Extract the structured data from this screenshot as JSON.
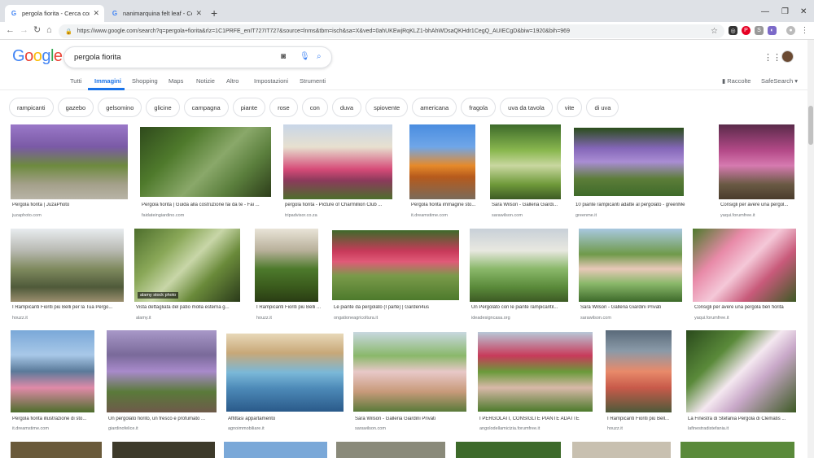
{
  "browser": {
    "tabs": [
      {
        "title": "pergola fiorita - Cerca con Google",
        "active": true
      },
      {
        "title": "nanimarquina felt leaf - Cerca con Google",
        "active": false
      }
    ],
    "url": "https://www.google.com/search?q=pergola+fiorita&rlz=1C1PRFE_enIT727IT727&source=lnms&tbm=isch&sa=X&ved=0ahUKEwjRqKLZ1-bhAhWDsaQKHdr1CegQ_AUIECgD&biw=1920&bih=969"
  },
  "google": {
    "logo": "Google",
    "query": "pergola fiorita",
    "tabs": [
      "Tutti",
      "Immagini",
      "Shopping",
      "Maps",
      "Notizie",
      "Altro",
      "Impostazioni",
      "Strumenti"
    ],
    "raccolte": "Raccolte",
    "safesearch": "SafeSearch ▾",
    "chips": [
      "rampicanti",
      "gazebo",
      "gelsomino",
      "glicine",
      "campagna",
      "piante",
      "rose",
      "con",
      "duva",
      "spiovente",
      "americana",
      "fragola",
      "uva da tavola",
      "vite",
      "di uva"
    ]
  },
  "results": [
    {
      "caption": "Pergola fiorita | JuzaPhoto",
      "source": "juzaphoto.com"
    },
    {
      "caption": "Pergola fiorita | Guida alla costruzione fai da te - Fai ...",
      "source": "faidateingiardino.com"
    },
    {
      "caption": "pergola fiorita - Picture of Charmillion Club ...",
      "source": "tripadvisor.co.za"
    },
    {
      "caption": "Pergola fiorita immagine sto...",
      "source": "it.dreamstime.com"
    },
    {
      "caption": "Sara Wilson - Galleria Giardi...",
      "source": "sarawilson.com"
    },
    {
      "caption": "10 piante rampicanti adatte al pergolato - greenMe",
      "source": "greenme.it"
    },
    {
      "caption": "Consigli per avere una pergol...",
      "source": "yaqui.forumfree.it"
    },
    {
      "caption": "I Rampicanti Fioriti più Belli per la Tua Pergo...",
      "source": "houzz.it"
    },
    {
      "caption": "Vista dettagliata del patio molla esterna g...",
      "source": "alamy.it"
    },
    {
      "caption": "I Rampicanti Fioriti più Belli ...",
      "source": "houzz.it"
    },
    {
      "caption": "Le piante da pergolato (I parte) | Garden4us",
      "source": "ongationeagricoltura.it"
    },
    {
      "caption": "Un Pergolato con le piante rampicantil...",
      "source": "ideadesigncasa.org"
    },
    {
      "caption": "Sara Wilson - Galleria Giardini Privati",
      "source": "sarawilson.com"
    },
    {
      "caption": "Consigli per avere una pergola ben fiorita",
      "source": "yaqui.forumfree.it"
    },
    {
      "caption": "Pergola fiorita illustrazione di sto...",
      "source": "it.dreamstime.com"
    },
    {
      "caption": "Un pergolato fiorito, un fresco e profumato ...",
      "source": "giardinofelice.it"
    },
    {
      "caption": "Affittasi appartamento",
      "source": "agnoimmobiliare.it"
    },
    {
      "caption": "Sara Wilson - Galleria Giardini Privati",
      "source": "sarawilson.com"
    },
    {
      "caption": "I PERGOLATI, CONSIGLI E PIANTE ADATTE",
      "source": "angolodellamicizia.forumfree.it"
    },
    {
      "caption": "I Rampicanti Fioriti più Bell...",
      "source": "houzz.it"
    },
    {
      "caption": "La Finestra di Stefania Pergola di Clematis ...",
      "source": "lafinestradistefania.it"
    }
  ],
  "watermark": "alamy stock photo",
  "colors": {
    "accent": "#1a73e8",
    "blue": "#4285f4",
    "red": "#ea4335",
    "yellow": "#fbbc05",
    "green": "#34a853"
  }
}
